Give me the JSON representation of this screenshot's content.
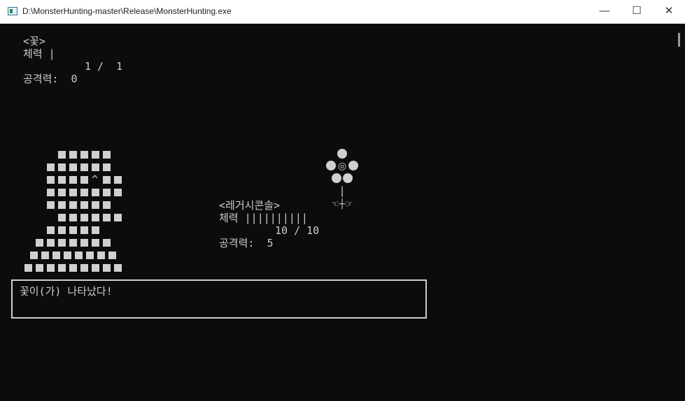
{
  "window": {
    "title": "D:\\MonsterHunting-master\\Release\\MonsterHunting.exe",
    "minimize_glyph": "—",
    "maximize_glyph": "☐",
    "close_glyph": "✕"
  },
  "enemy": {
    "name": "<꽃>",
    "hp_line": "체력 |",
    "hp_value": "1 /  1",
    "atk_line": "공격력:  0",
    "sprite_glyph_center": "◎",
    "sprite_glyph_stem": "|",
    "sprite_glyph_leaves": "☜┼☞"
  },
  "player": {
    "name": "<레거시콘솔>",
    "hp_line": "체력 ||||||||||",
    "hp_value": "10 / 10",
    "atk_line": "공격력:  5",
    "sprite_glyph_mark": "^"
  },
  "dialog": {
    "message": "꽃이(가) 나타났다!"
  }
}
